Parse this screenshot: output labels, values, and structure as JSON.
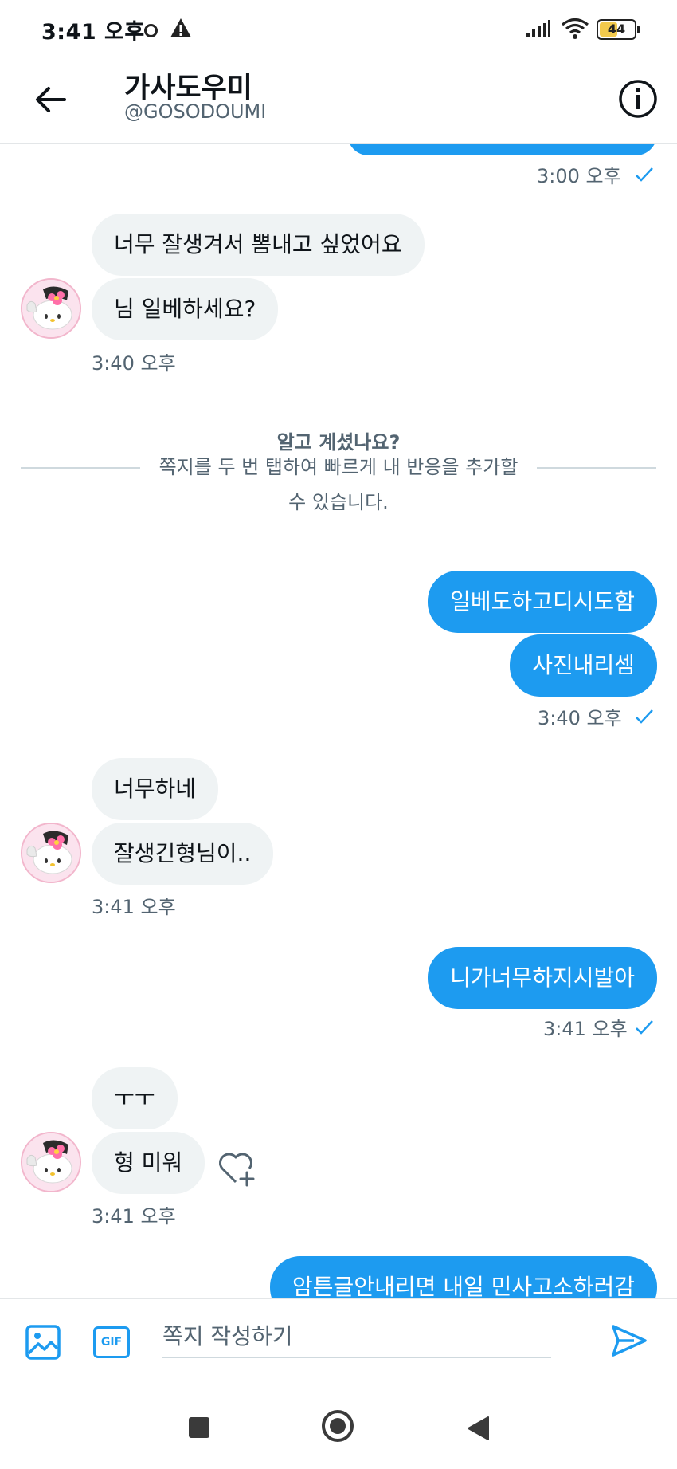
{
  "status_bar": {
    "time": "3:41 오후",
    "battery": "44"
  },
  "header": {
    "title": "가사도우미",
    "handle": "@GOSODOUMI"
  },
  "messages": {
    "first_time": "3:00 오후",
    "g1": {
      "m1": "너무 잘생겨서 뽐내고 싶었어요",
      "m2": "님 일베하세요?",
      "time": "3:40 오후"
    },
    "notice": {
      "title": "알고 계셨나요?",
      "text": "쪽지를 두 번 탭하여 빠르게 내 반응을 추가할 수 있습니다."
    },
    "g2": {
      "m1": "일베도하고디시도함",
      "m2": "사진내리셈",
      "time": "3:40 오후"
    },
    "g3": {
      "m1": "너무하네",
      "m2": "잘생긴형님이..",
      "time": "3:41 오후"
    },
    "g4": {
      "m1": "니가너무하지시발아",
      "time": "3:41 오후"
    },
    "g5": {
      "m1": "ㅜㅜ",
      "m2": "형 미워",
      "time": "3:41 오후"
    },
    "g6": {
      "m1": "암튼글안내리면 내일 민사고소하러감"
    }
  },
  "composer": {
    "placeholder": "쪽지 작성하기",
    "gif_label": "GIF"
  },
  "colors": {
    "accent": "#1d9bf0",
    "incoming_bubble": "#eff3f4",
    "muted_text": "#536471"
  },
  "icons": [
    "back-arrow-icon",
    "info-icon",
    "read-check-icon",
    "heart-plus-icon",
    "image-icon",
    "gif-icon",
    "send-icon",
    "nav-square-icon",
    "nav-home-icon",
    "nav-back-icon"
  ]
}
